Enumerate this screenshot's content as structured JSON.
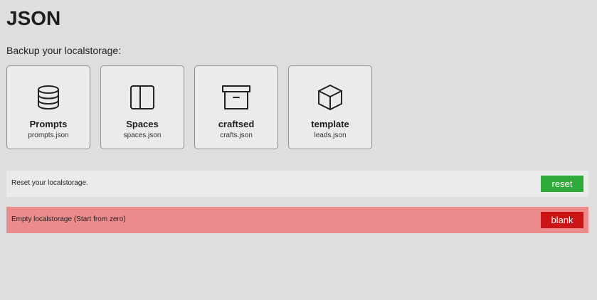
{
  "page": {
    "title": "JSON",
    "subtitle": "Backup your localstorage:"
  },
  "backups": [
    {
      "icon": "database-icon",
      "title": "Prompts",
      "file": "prompts.json"
    },
    {
      "icon": "sidebar-layout-icon",
      "title": "Spaces",
      "file": "spaces.json"
    },
    {
      "icon": "archive-box-icon",
      "title": "craftsed",
      "file": "crafts.json"
    },
    {
      "icon": "cube-icon",
      "title": "template",
      "file": "leads.json"
    }
  ],
  "reset": {
    "text": "Reset your localstorage.",
    "button_label": "reset",
    "button_color": "#2eaa3a",
    "background": "#ebebeb"
  },
  "blank": {
    "text": "Empty localstorage (Start from zero)",
    "button_label": "blank",
    "button_color": "#cb1416",
    "background": "#ec8b8b"
  }
}
